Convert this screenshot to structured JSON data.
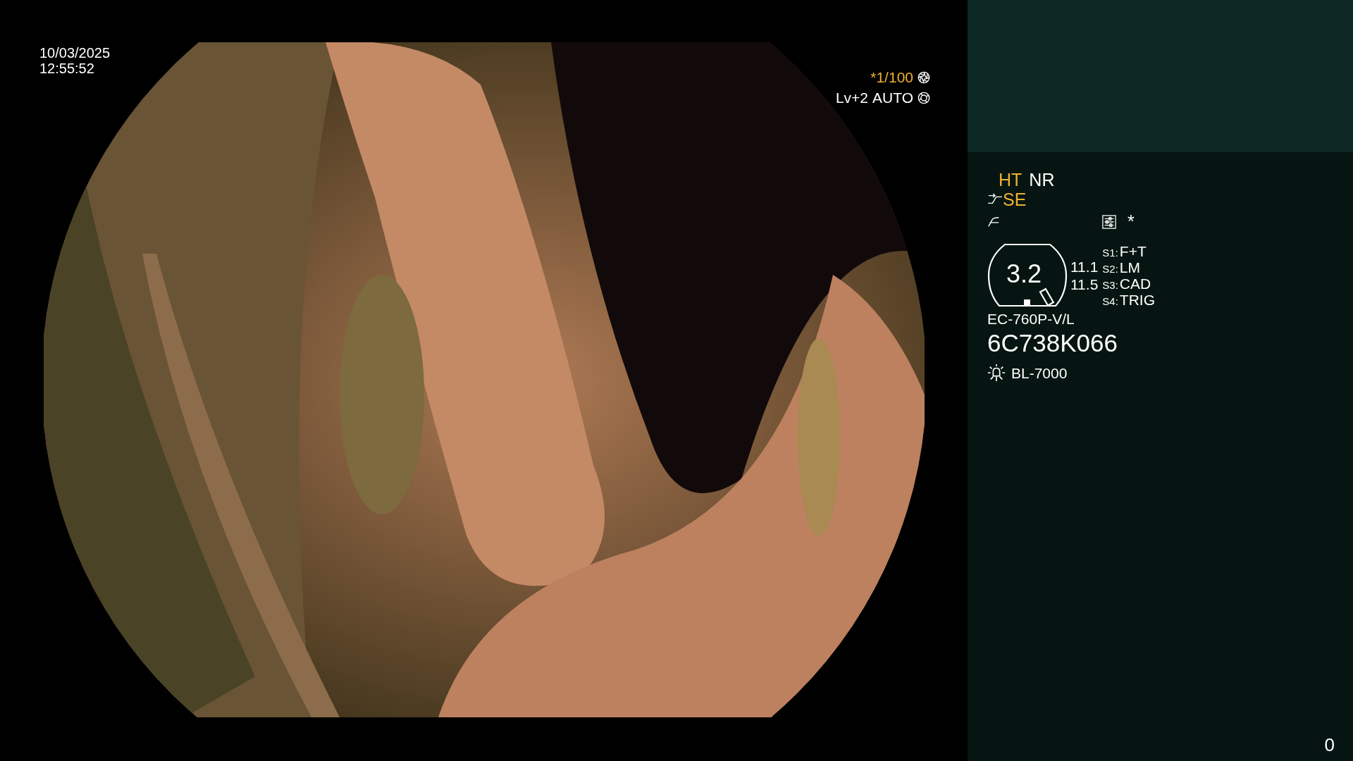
{
  "timestamp": {
    "date": "10/03/2025",
    "time": "12:55:52"
  },
  "exposure": {
    "shutter": {
      "label": "*1/100",
      "highlighted": true
    },
    "level": "Lv+2",
    "mode": "AUTO"
  },
  "panel": {
    "modes": [
      {
        "label": "HT",
        "highlighted": true
      },
      {
        "label": "NR",
        "highlighted": false
      }
    ],
    "enhancement": {
      "label": "SE",
      "highlighted": true
    },
    "marker": "*",
    "zoom": {
      "value": "3.2",
      "readings": [
        "11.1",
        "11.5"
      ]
    },
    "switches": [
      {
        "key": "S1:",
        "value": "F+T"
      },
      {
        "key": "S2:",
        "value": "LM"
      },
      {
        "key": "S3:",
        "value": "CAD"
      },
      {
        "key": "S4:",
        "value": "TRIG"
      }
    ],
    "scope_model": "EC-760P-V/L",
    "serial": "6C738K066",
    "light_source": "BL-7000"
  },
  "counter": "0"
}
